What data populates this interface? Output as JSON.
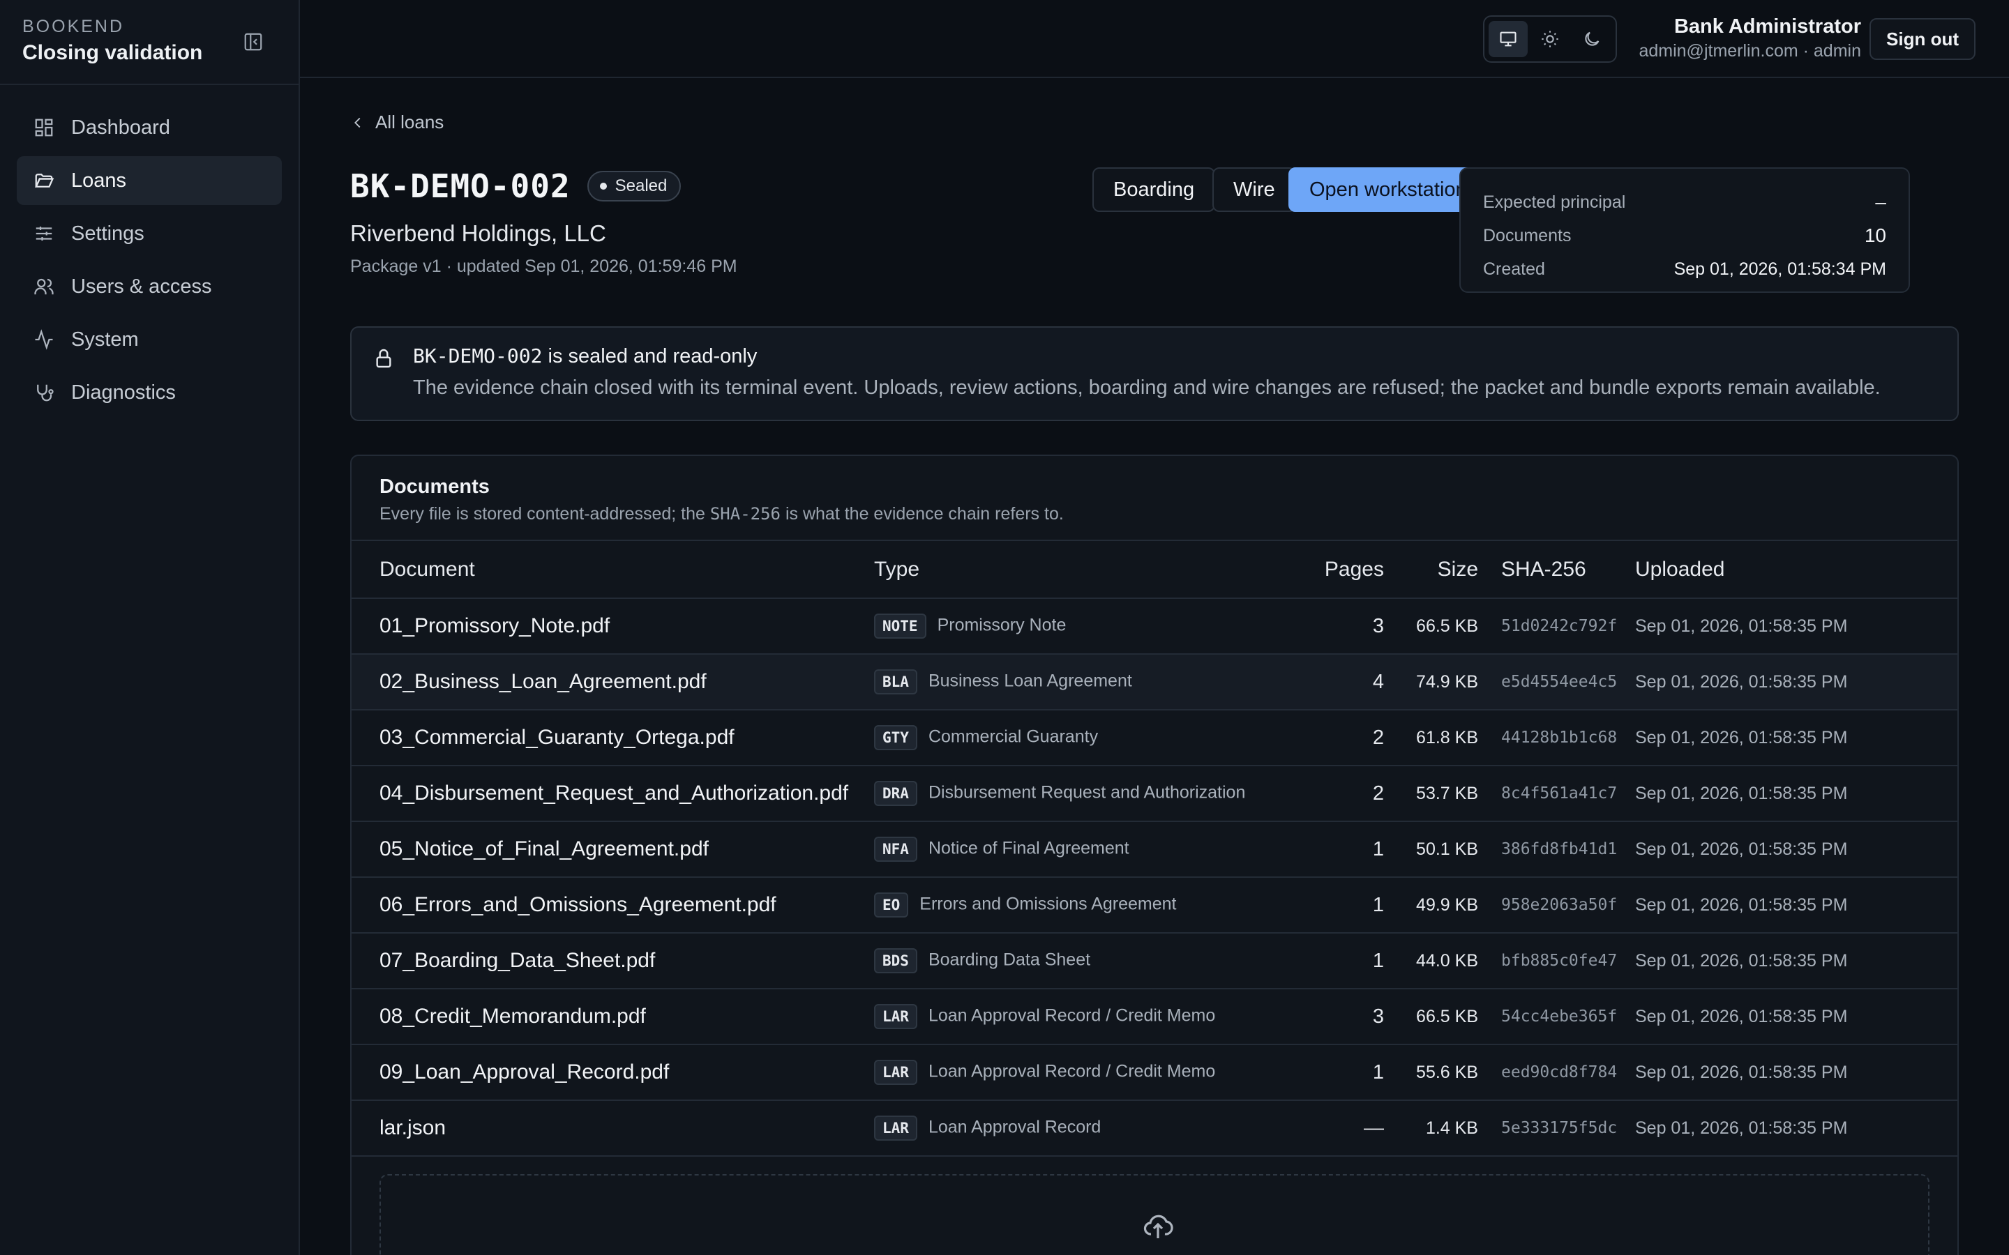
{
  "brand": {
    "kicker": "BOOKEND",
    "title": "Closing validation"
  },
  "nav": [
    {
      "label": "Dashboard",
      "icon": "dashboard-icon"
    },
    {
      "label": "Loans",
      "icon": "folder-icon",
      "active": true
    },
    {
      "label": "Settings",
      "icon": "sliders-icon"
    },
    {
      "label": "Users & access",
      "icon": "users-icon"
    },
    {
      "label": "System",
      "icon": "activity-icon"
    },
    {
      "label": "Diagnostics",
      "icon": "stethoscope-icon"
    }
  ],
  "topbar": {
    "user_name": "Bank Administrator",
    "user_meta": "admin@jtmerlin.com · admin",
    "signout": "Sign out",
    "theme_selected": "system"
  },
  "loan": {
    "back": "All loans",
    "id": "BK-DEMO-002",
    "status": "Sealed",
    "borrower": "Riverbend Holdings, LLC",
    "meta": "Package v1 · updated Sep 01, 2026, 01:59:46 PM"
  },
  "actions": {
    "boarding": "Boarding",
    "wire": "Wire",
    "open": "Open workstation"
  },
  "summary": {
    "principal_label": "Expected principal",
    "principal_value": "–",
    "documents_label": "Documents",
    "documents_value": "10",
    "created_label": "Created",
    "created_value": "Sep 01, 2026, 01:58:34 PM"
  },
  "notice": {
    "id": "BK-DEMO-002",
    "title_suffix": " is sealed and read-only",
    "body": "The evidence chain closed with its terminal event. Uploads, review actions, boarding and wire changes are refused; the packet and bundle exports remain available."
  },
  "documents": {
    "title": "Documents",
    "subtitle_pre": "Every file is stored content-addressed; the ",
    "subtitle_code": "SHA-256",
    "subtitle_post": " is what the evidence chain refers to.",
    "columns": {
      "document": "Document",
      "type": "Type",
      "pages": "Pages",
      "size": "Size",
      "sha": "SHA-256",
      "uploaded": "Uploaded"
    },
    "rows": [
      {
        "name": "01_Promissory_Note.pdf",
        "code": "NOTE",
        "type": "Promissory Note",
        "pages": "3",
        "size": "66.5 KB",
        "sha": "51d0242c792f",
        "uploaded": "Sep 01, 2026, 01:58:35 PM"
      },
      {
        "name": "02_Business_Loan_Agreement.pdf",
        "code": "BLA",
        "type": "Business Loan Agreement",
        "pages": "4",
        "size": "74.9 KB",
        "sha": "e5d4554ee4c5",
        "uploaded": "Sep 01, 2026, 01:58:35 PM"
      },
      {
        "name": "03_Commercial_Guaranty_Ortega.pdf",
        "code": "GTY",
        "type": "Commercial Guaranty",
        "pages": "2",
        "size": "61.8 KB",
        "sha": "44128b1b1c68",
        "uploaded": "Sep 01, 2026, 01:58:35 PM"
      },
      {
        "name": "04_Disbursement_Request_and_Authorization.pdf",
        "code": "DRA",
        "type": "Disbursement Request and Authorization",
        "pages": "2",
        "size": "53.7 KB",
        "sha": "8c4f561a41c7",
        "uploaded": "Sep 01, 2026, 01:58:35 PM"
      },
      {
        "name": "05_Notice_of_Final_Agreement.pdf",
        "code": "NFA",
        "type": "Notice of Final Agreement",
        "pages": "1",
        "size": "50.1 KB",
        "sha": "386fd8fb41d1",
        "uploaded": "Sep 01, 2026, 01:58:35 PM"
      },
      {
        "name": "06_Errors_and_Omissions_Agreement.pdf",
        "code": "EO",
        "type": "Errors and Omissions Agreement",
        "pages": "1",
        "size": "49.9 KB",
        "sha": "958e2063a50f",
        "uploaded": "Sep 01, 2026, 01:58:35 PM"
      },
      {
        "name": "07_Boarding_Data_Sheet.pdf",
        "code": "BDS",
        "type": "Boarding Data Sheet",
        "pages": "1",
        "size": "44.0 KB",
        "sha": "bfb885c0fe47",
        "uploaded": "Sep 01, 2026, 01:58:35 PM"
      },
      {
        "name": "08_Credit_Memorandum.pdf",
        "code": "LAR",
        "type": "Loan Approval Record / Credit Memo",
        "pages": "3",
        "size": "66.5 KB",
        "sha": "54cc4ebe365f",
        "uploaded": "Sep 01, 2026, 01:58:35 PM"
      },
      {
        "name": "09_Loan_Approval_Record.pdf",
        "code": "LAR",
        "type": "Loan Approval Record / Credit Memo",
        "pages": "1",
        "size": "55.6 KB",
        "sha": "eed90cd8f784",
        "uploaded": "Sep 01, 2026, 01:58:35 PM"
      },
      {
        "name": "lar.json",
        "code": "LAR",
        "type": "Loan Approval Record",
        "pages": "—",
        "size": "1.4 KB",
        "sha": "5e333175f5dc",
        "uploaded": "Sep 01, 2026, 01:58:35 PM"
      }
    ],
    "dropzone_icon": "cloud-upload-icon"
  },
  "colors": {
    "accent": "#6ea6f7",
    "background": "#0b0f15",
    "sidebar": "#10151d"
  }
}
